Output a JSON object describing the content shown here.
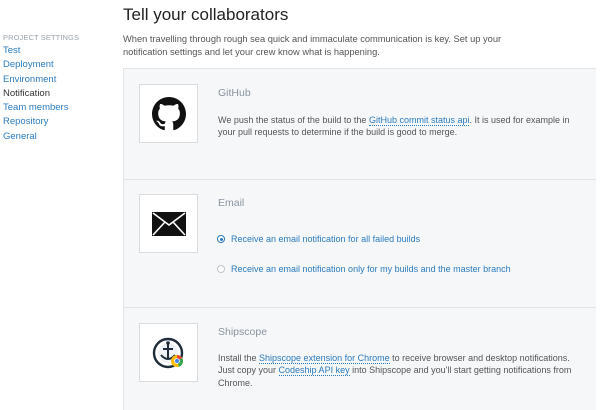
{
  "sidebar": {
    "heading": "PROJECT SETTINGS",
    "items": [
      {
        "label": "Test",
        "active": false
      },
      {
        "label": "Deployment",
        "active": false
      },
      {
        "label": "Environment",
        "active": false
      },
      {
        "label": "Notification",
        "active": true
      },
      {
        "label": "Team members",
        "active": false
      },
      {
        "label": "Repository",
        "active": false
      },
      {
        "label": "General",
        "active": false
      }
    ]
  },
  "main": {
    "title": "Tell your collaborators",
    "intro": "When travelling through rough sea quick and immaculate communication is key. Set up your notification settings and let your crew know what is happening."
  },
  "github": {
    "title": "GitHub",
    "desc_before": "We push the status of the build to the ",
    "link": "GitHub commit status api",
    "desc_after": ". It is used for example in your pull requests to determine if the build is good to merge.",
    "icon": "github-icon"
  },
  "email": {
    "title": "Email",
    "icon": "envelope-icon",
    "options": [
      {
        "label": "Receive an email notification for all failed builds",
        "checked": true
      },
      {
        "label": "Receive an email notification only for my builds and the master branch",
        "checked": false
      }
    ]
  },
  "shipscope": {
    "title": "Shipscope",
    "icon": "shipscope-icon",
    "desc_1": "Install the ",
    "link_1": "Shipscope extension for Chrome",
    "desc_2": " to receive browser and desktop notifications. Just copy your ",
    "link_2": "Codeship API key",
    "desc_3": " into Shipscope and you'll start getting notifications from Chrome."
  },
  "colors": {
    "link": "#2b7bbf",
    "panel_bg": "#f6f7f8",
    "muted_title": "#8a95a0"
  }
}
